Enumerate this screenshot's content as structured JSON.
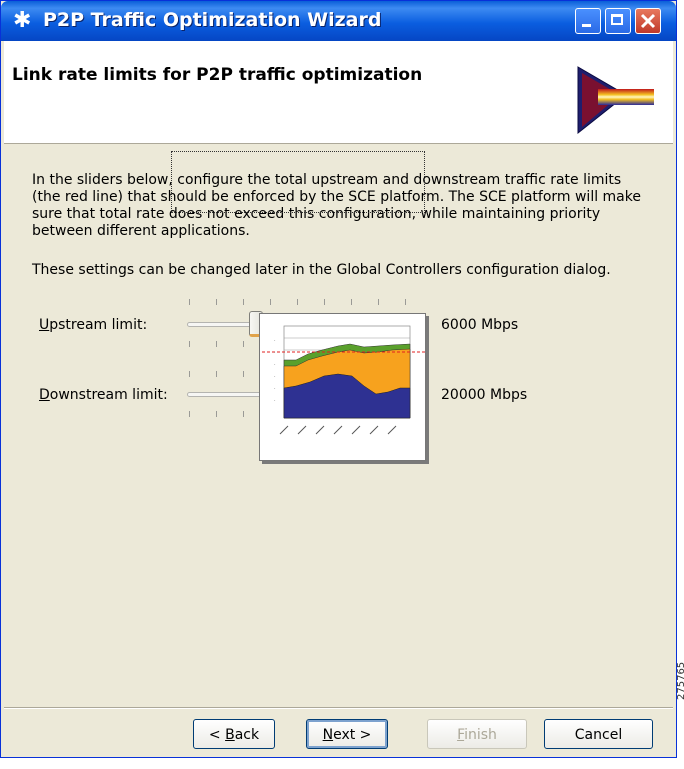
{
  "window": {
    "title": "P2P Traffic Optimization Wizard",
    "app_icon": "✱"
  },
  "header": {
    "title": "Link rate limits for P2P traffic optimization",
    "banner_icon": "wizard-banner-arrow-icon"
  },
  "content": {
    "description": "In the sliders below, configure the total upstream and downstream traffic rate limits (the red line) that should be enforced by the SCE platform. The SCE platform will make sure that total rate does not exceed this configuration, while maintaining priority between different applications.",
    "note": "These settings can be changed later in the Global Controllers configuration dialog."
  },
  "sliders": {
    "upstream": {
      "label_key": "U",
      "label_rest": "pstream limit:",
      "value_text": "6000 Mbps",
      "position_fraction": 0.3
    },
    "downstream": {
      "label_key": "D",
      "label_rest": "ownstream limit:",
      "value_text": "20000 Mbps",
      "position_fraction": 1.0
    }
  },
  "buttons": {
    "back": {
      "pre": "< ",
      "key": "B",
      "rest": "ack"
    },
    "next": {
      "key": "N",
      "rest": "ext >"
    },
    "finish": {
      "key": "F",
      "rest": "inish"
    },
    "cancel": "Cancel"
  },
  "watermark": "275765",
  "colors": {
    "titlebar": "#0a5fd8",
    "dialog_bg": "#ece9d8",
    "chart_blue": "#2e3192",
    "chart_orange": "#f7a21e",
    "chart_green": "#5aa02c",
    "rate_limit_line": "#e02020"
  }
}
